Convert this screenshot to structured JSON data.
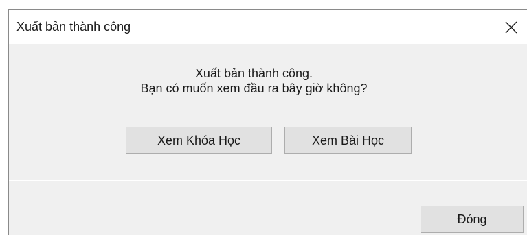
{
  "dialog": {
    "title": "Xuất bản thành công",
    "message_line1": "Xuất bản thành công.",
    "message_line2": "Bạn có muốn xem đầu ra bây giờ không?",
    "buttons": {
      "view_course": "Xem Khóa Học",
      "view_lesson": "Xem Bài Học",
      "close": "Đóng"
    },
    "close_icon": "close-icon"
  }
}
